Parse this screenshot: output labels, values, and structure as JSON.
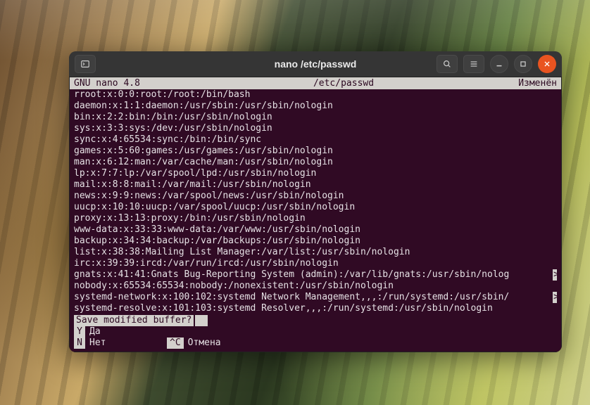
{
  "window": {
    "title": "nano /etc/passwd"
  },
  "nano": {
    "version": "GNU nano 4.8",
    "filename": "/etc/passwd",
    "status": "Изменён",
    "prompt": "Save modified buffer?",
    "lines": [
      "rroot:x:0:0:root:/root:/bin/bash",
      "daemon:x:1:1:daemon:/usr/sbin:/usr/sbin/nologin",
      "bin:x:2:2:bin:/bin:/usr/sbin/nologin",
      "sys:x:3:3:sys:/dev:/usr/sbin/nologin",
      "sync:x:4:65534:sync:/bin:/bin/sync",
      "games:x:5:60:games:/usr/games:/usr/sbin/nologin",
      "man:x:6:12:man:/var/cache/man:/usr/sbin/nologin",
      "lp:x:7:7:lp:/var/spool/lpd:/usr/sbin/nologin",
      "mail:x:8:8:mail:/var/mail:/usr/sbin/nologin",
      "news:x:9:9:news:/var/spool/news:/usr/sbin/nologin",
      "uucp:x:10:10:uucp:/var/spool/uucp:/usr/sbin/nologin",
      "proxy:x:13:13:proxy:/bin:/usr/sbin/nologin",
      "www-data:x:33:33:www-data:/var/www:/usr/sbin/nologin",
      "backup:x:34:34:backup:/var/backups:/usr/sbin/nologin",
      "list:x:38:38:Mailing List Manager:/var/list:/usr/sbin/nologin",
      "irc:x:39:39:ircd:/var/run/ircd:/usr/sbin/nologin",
      "gnats:x:41:41:Gnats Bug-Reporting System (admin):/var/lib/gnats:/usr/sbin/nolog",
      "nobody:x:65534:65534:nobody:/nonexistent:/usr/sbin/nologin",
      "systemd-network:x:100:102:systemd Network Management,,,:/run/systemd:/usr/sbin/",
      "systemd-resolve:x:101:103:systemd Resolver,,,:/run/systemd:/usr/sbin/nologin"
    ],
    "cont_lines": [
      16,
      18
    ],
    "shortcuts": {
      "row1": [
        {
          "key": "Y",
          "label": "Да"
        }
      ],
      "row2": [
        {
          "key": "N",
          "label": "Нет"
        },
        {
          "key": "^C",
          "label": "Отмена"
        }
      ]
    }
  }
}
